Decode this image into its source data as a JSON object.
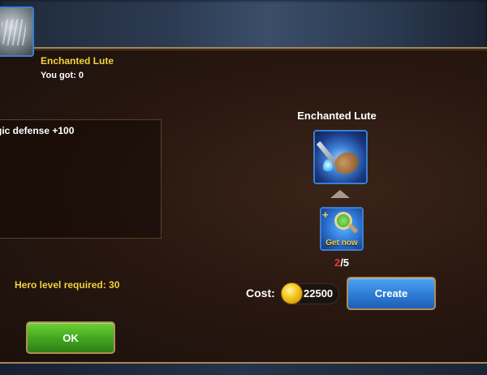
{
  "left": {
    "item_title": "Enchanted Lute",
    "you_got": "You got:  0",
    "stats": "gic defense +100",
    "hero_level": "Hero level required:  30",
    "ok_label": "OK"
  },
  "right": {
    "title": "Enchanted Lute",
    "get_now": "Get now",
    "have": "2",
    "need": "/5",
    "cost_label": "Cost:",
    "cost_value": "22500",
    "create_label": "Create"
  },
  "icons": {
    "item_small": "lute-icon",
    "item_big": "enchanted-lute-icon",
    "arrow": "up-arrow-icon",
    "source": "magnifier-get-now-icon",
    "coin": "gold-coin-icon"
  },
  "colors": {
    "gold_text": "#f2d23c",
    "slot_border": "#3b7fd1",
    "ok_green": "#45a821",
    "create_blue": "#2f7fd8",
    "count_have": "#e23b3b"
  }
}
